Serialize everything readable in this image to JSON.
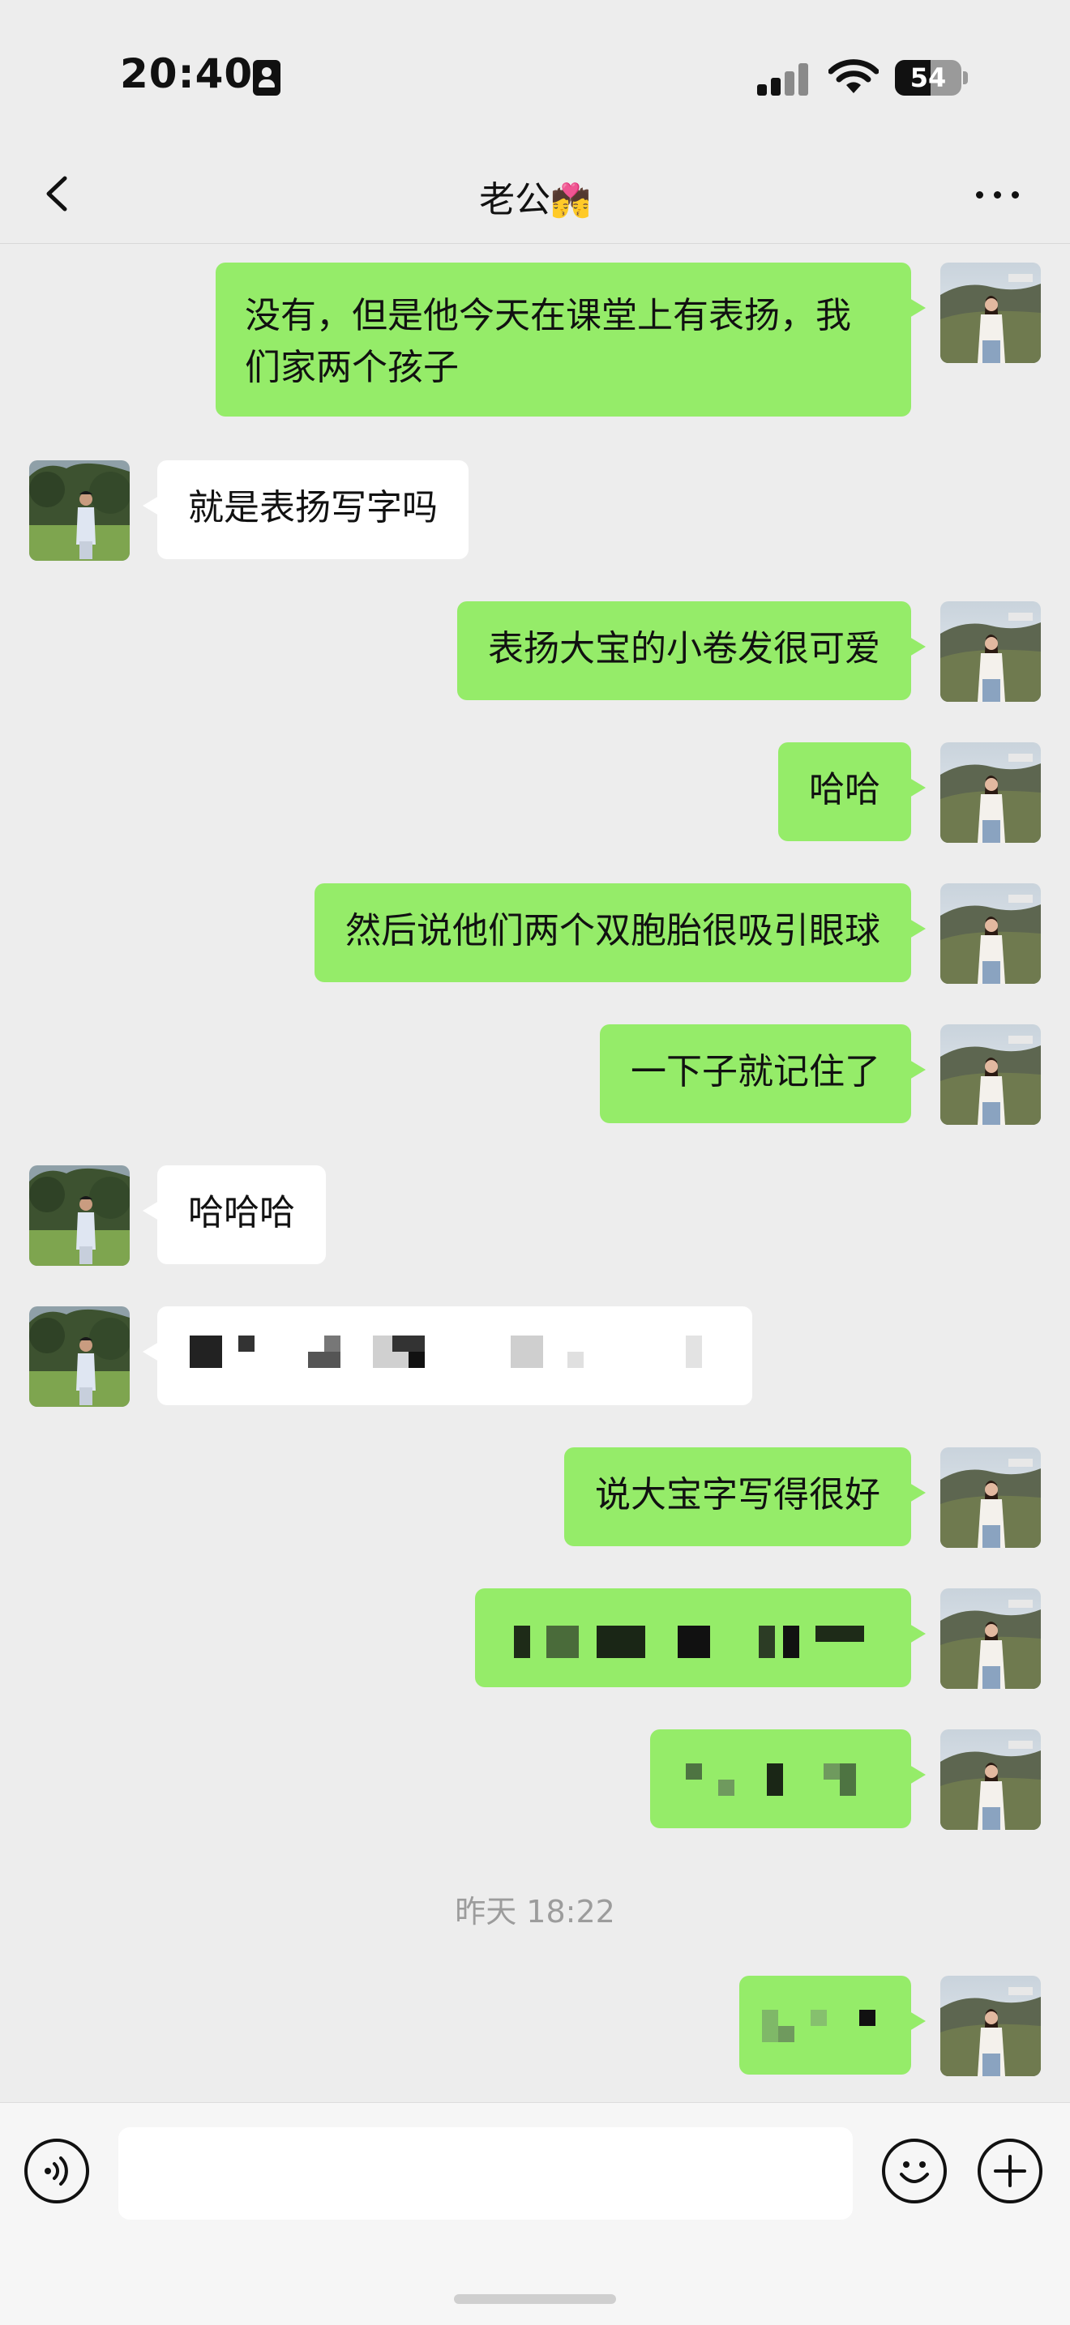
{
  "status_bar": {
    "time": "20:40",
    "battery_percent": 54,
    "battery_label": "54",
    "icons": [
      "contact-card-icon",
      "cellular-signal-icon",
      "wifi-icon",
      "battery-icon"
    ]
  },
  "nav": {
    "title": "老公",
    "title_emoji": "💏",
    "icons": [
      "back-chevron-icon",
      "more-dots-icon"
    ]
  },
  "colors": {
    "outgoing_bubble": "#95ec69",
    "incoming_bubble": "#ffffff",
    "background": "#ededed"
  },
  "messages": [
    {
      "sender": "me",
      "text": "没有，但是他今天在课堂上有表扬，我们家两个孩子"
    },
    {
      "sender": "him",
      "text": "就是表扬写字吗"
    },
    {
      "sender": "me",
      "text": "表扬大宝的小卷发很可爱"
    },
    {
      "sender": "me",
      "text": "哈哈"
    },
    {
      "sender": "me",
      "text": "然后说他们两个双胞胎很吸引眼球"
    },
    {
      "sender": "me",
      "text": "一下子就记住了"
    },
    {
      "sender": "him",
      "text": "哈哈哈"
    },
    {
      "sender": "him",
      "text": "",
      "redacted": true
    },
    {
      "sender": "me",
      "text": "说大宝字写得很好"
    },
    {
      "sender": "me",
      "text": "",
      "redacted": true
    },
    {
      "sender": "me",
      "text": "",
      "redacted": true
    },
    {
      "sender": "me",
      "text": "",
      "redacted": true
    }
  ],
  "timestamp": "昨天 18:22",
  "input_bar": {
    "placeholder": "",
    "icons": [
      "voice-icon",
      "emoji-icon",
      "plus-icon"
    ]
  }
}
